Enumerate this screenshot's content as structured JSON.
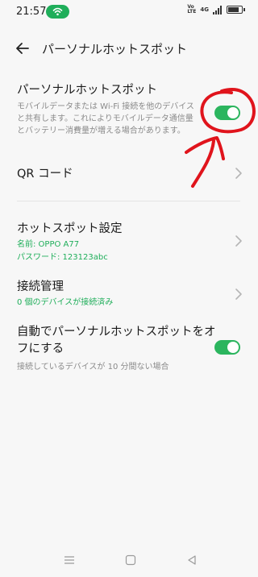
{
  "status": {
    "time": "21:57",
    "volte": "Vo\nLTE",
    "network": "4G"
  },
  "header": {
    "title": "パーソナルホットスポット"
  },
  "hotspot": {
    "title": "パーソナルホットスポット",
    "description": "モバイルデータまたは Wi-Fi 接続を他のデバイスと共有します。これによりモバイルデータ通信量とバッテリー消費量が増える場合があります。",
    "enabled": true
  },
  "qr": {
    "label": "QR コード"
  },
  "settings": {
    "title": "ホットスポット設定",
    "name_line": "名前: OPPO A77",
    "password_line": "パスワード: 123123abc"
  },
  "connections": {
    "title": "接続管理",
    "summary": "0 個のデバイスが接続済み"
  },
  "autooff": {
    "title": "自動でパーソナルホットスポットをオフにする",
    "description": "接続しているデバイスが 10 分間ない場合",
    "enabled": true
  },
  "colors": {
    "accent": "#1fae5a",
    "annotation": "#e0141c"
  }
}
